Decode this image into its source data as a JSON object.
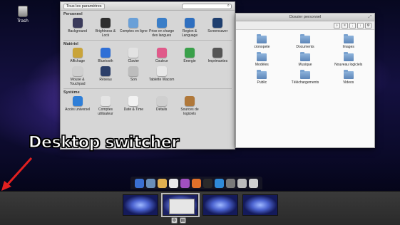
{
  "desktop": {
    "trash_label": "Trash"
  },
  "settings": {
    "all_settings_label": "Tous les paramètres",
    "search_icon": "magnifier-icon",
    "sections": [
      {
        "title": "Personnel",
        "items": [
          {
            "label": "Background",
            "icon": "background-icon",
            "color": "#3a3a5a"
          },
          {
            "label": "Brightness & Lock",
            "icon": "brightness-lock-icon",
            "color": "#2e2e2e"
          },
          {
            "label": "Comptes en ligne",
            "icon": "online-accounts-icon",
            "color": "#6aa0d8"
          },
          {
            "label": "Prise en charge des langues",
            "icon": "language-flag-icon",
            "color": "#3a7ec8"
          },
          {
            "label": "Region & Language",
            "icon": "region-globe-icon",
            "color": "#2f6fbf"
          },
          {
            "label": "Screensaver",
            "icon": "screensaver-icon",
            "color": "#1f3f6f"
          }
        ]
      },
      {
        "title": "Matériel",
        "items": [
          {
            "label": "Affichage",
            "icon": "display-icon",
            "color": "#c9a43a"
          },
          {
            "label": "Bluetooth",
            "icon": "bluetooth-icon",
            "color": "#2f6fd6"
          },
          {
            "label": "Clavier",
            "icon": "keyboard-icon",
            "color": "#e2e2e2"
          },
          {
            "label": "Couleur",
            "icon": "color-wheel-icon",
            "color": "#e05a8a"
          },
          {
            "label": "Énergie",
            "icon": "energy-battery-icon",
            "color": "#3aa04a"
          },
          {
            "label": "Imprimantes",
            "icon": "printer-icon",
            "color": "#555555"
          },
          {
            "label": "Mouse & Touchpad",
            "icon": "mouse-icon",
            "color": "#cfcfcf"
          },
          {
            "label": "Réseau",
            "icon": "network-icon",
            "color": "#2c3f6a"
          },
          {
            "label": "Son",
            "icon": "speaker-icon",
            "color": "#bdbdbd"
          },
          {
            "label": "Tablette Wacom",
            "icon": "wacom-tablet-icon",
            "color": "#e8e8e8"
          }
        ]
      },
      {
        "title": "Système",
        "items": [
          {
            "label": "Accès universel",
            "icon": "universal-access-icon",
            "color": "#2f7fd8"
          },
          {
            "label": "Comptes utilisateur",
            "icon": "users-icon",
            "color": "#e4e4e4"
          },
          {
            "label": "Date & Time",
            "icon": "clock-icon",
            "color": "#f2f2f2"
          },
          {
            "label": "Détails",
            "icon": "gear-details-icon",
            "color": "#cfcfcf"
          },
          {
            "label": "Sources de logiciels",
            "icon": "software-sources-icon",
            "color": "#b0783a"
          }
        ]
      }
    ]
  },
  "files": {
    "title": "Dossier personnel",
    "toolbar_icons": [
      "search-icon",
      "list-view-icon",
      "grid-view-icon",
      "download-icon",
      "settings-icon"
    ],
    "folders": [
      "cronopete",
      "Documents",
      "Images",
      "Modèles",
      "Musique",
      "Nouveau logiciels",
      "Public",
      "Téléchargements",
      "Videos"
    ]
  },
  "caption": "Desktop switcher",
  "dock": {
    "items": [
      {
        "icon": "finder-icon",
        "color": "#3a6fd0"
      },
      {
        "icon": "launcher-icon",
        "color": "#6a8fb8"
      },
      {
        "icon": "mail-icon",
        "color": "#e0b050"
      },
      {
        "icon": "calendar-icon",
        "color": "#e8e8e8"
      },
      {
        "icon": "itunes-icon",
        "color": "#a050c0"
      },
      {
        "icon": "firefox-icon",
        "color": "#e0702a"
      },
      {
        "icon": "terminal-icon",
        "color": "#2a2a2a"
      },
      {
        "icon": "safari-icon",
        "color": "#2f8ad8"
      },
      {
        "icon": "system-prefs-icon",
        "color": "#7a7a7a"
      },
      {
        "icon": "disk-utility-icon",
        "color": "#bdbdbd"
      },
      {
        "icon": "trash-dock-icon",
        "color": "#d0d0d0"
      }
    ]
  },
  "switcher": {
    "workspaces": 4,
    "active_index": 1,
    "buttons": [
      {
        "icon": "settings-icon",
        "glyph": "⚙"
      },
      {
        "icon": "expose-icon",
        "glyph": "▤"
      }
    ]
  }
}
